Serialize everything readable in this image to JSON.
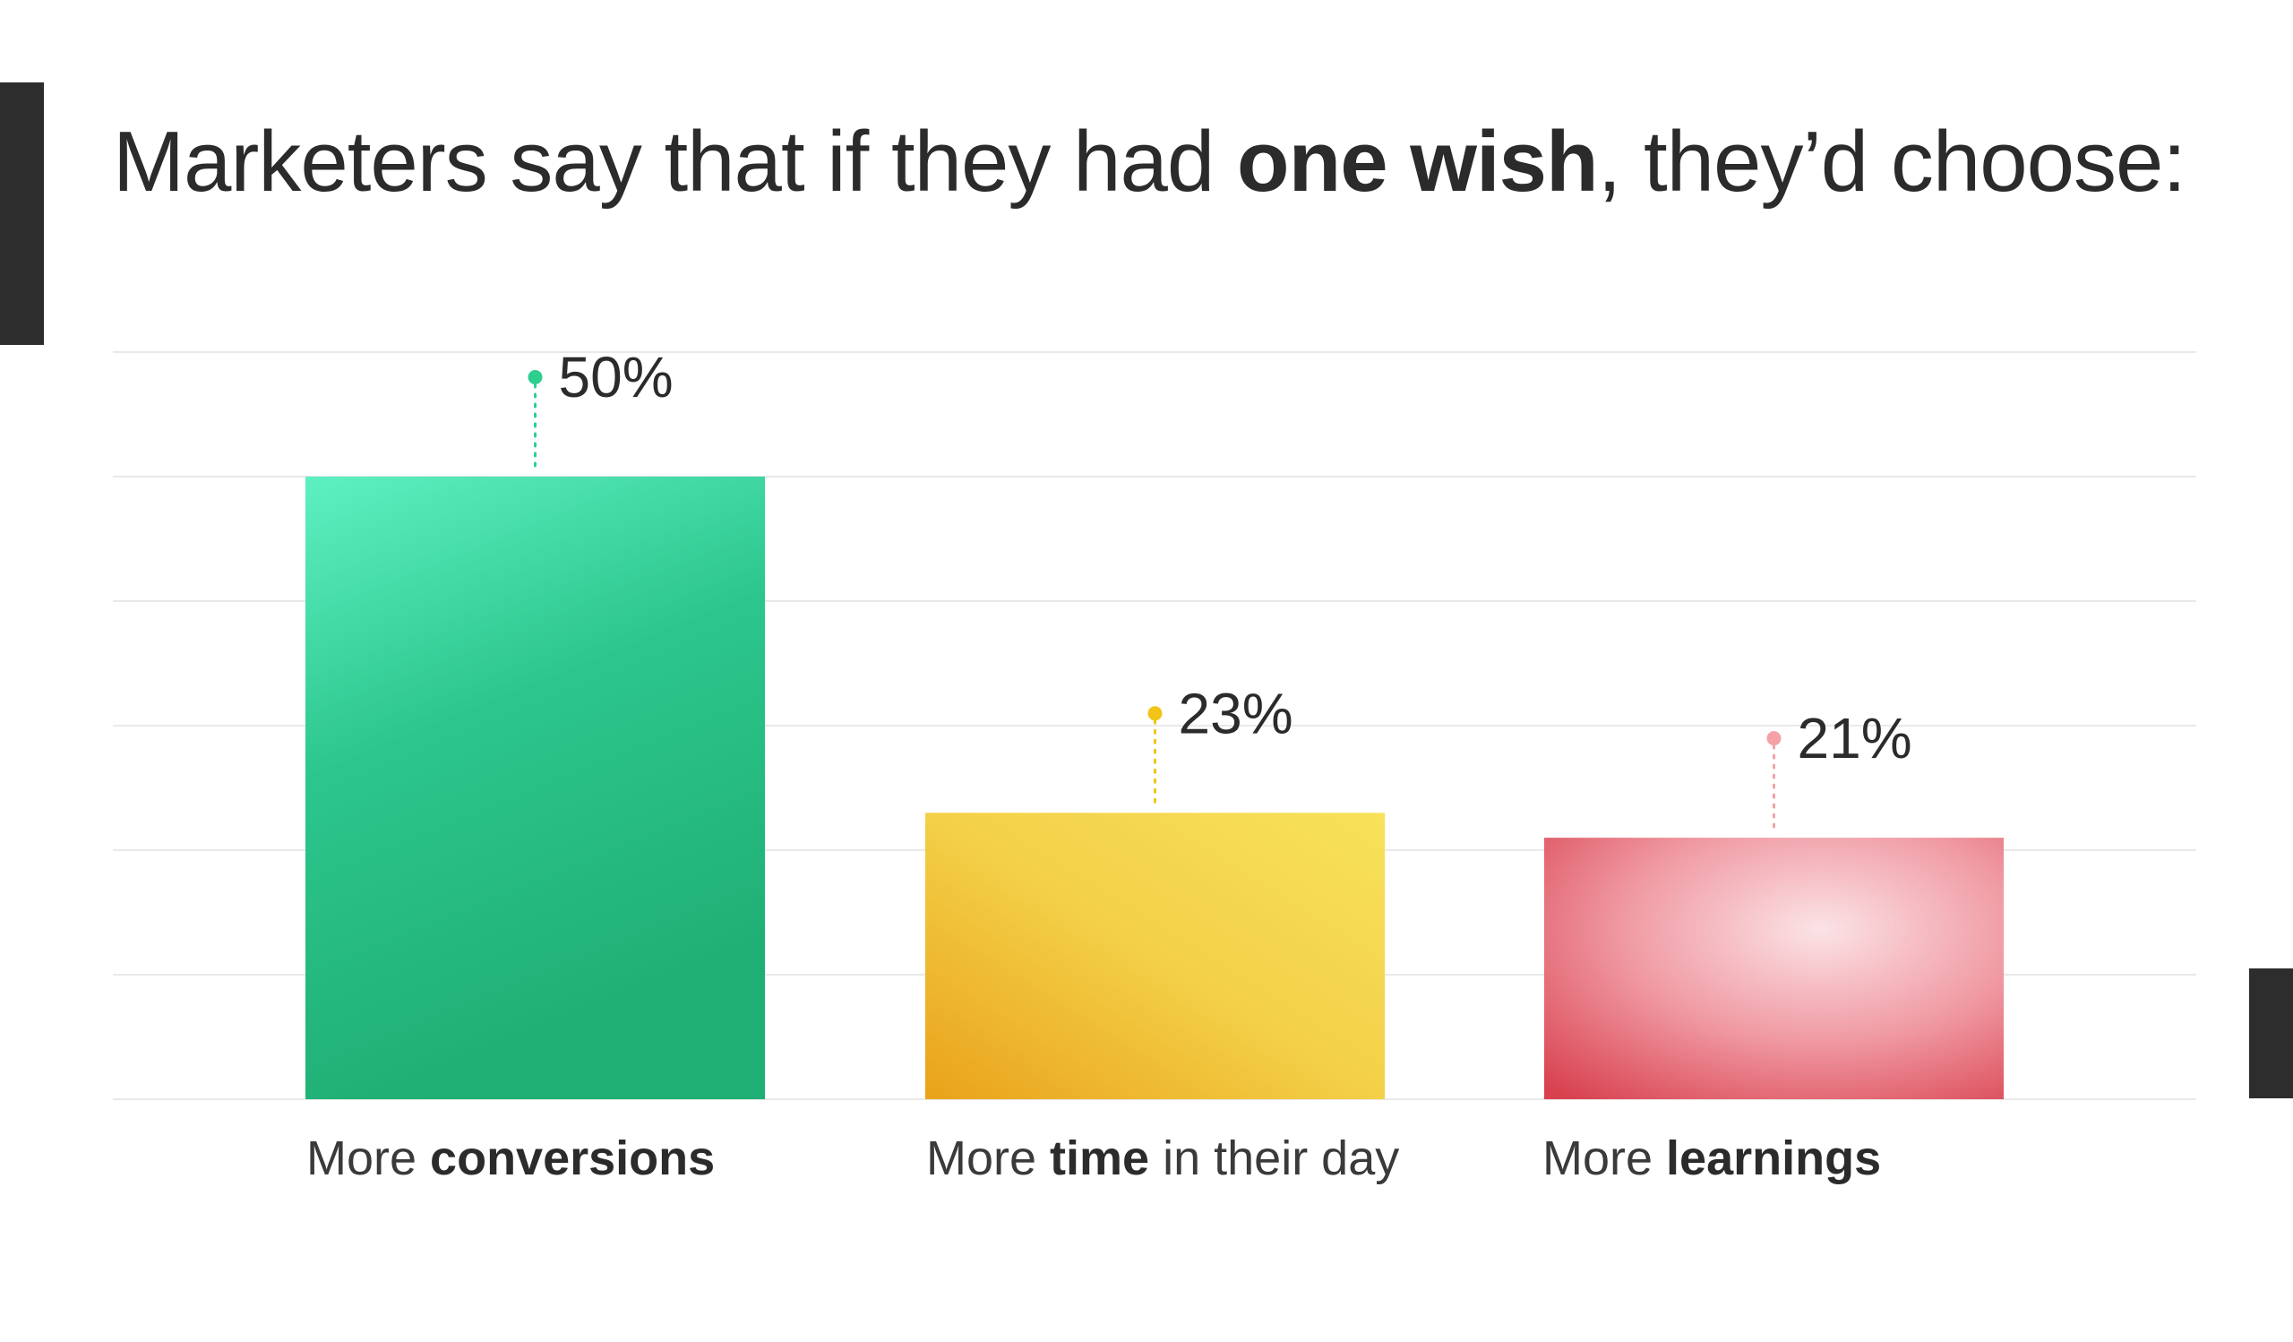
{
  "title": {
    "before": "Marketers say that if they had ",
    "emphasis": "one wish",
    "after": ", they’d choose:"
  },
  "chart_data": {
    "type": "bar",
    "title": "Marketers say that if they had one wish, they’d choose:",
    "categories": [
      "More conversions",
      "More time in their day",
      "More learnings"
    ],
    "category_parts": [
      {
        "prefix": "More ",
        "bold": "conversions",
        "suffix": ""
      },
      {
        "prefix": "More ",
        "bold": "time",
        "suffix": " in their day"
      },
      {
        "prefix": "More ",
        "bold": "learnings",
        "suffix": ""
      }
    ],
    "values": [
      50,
      23,
      21
    ],
    "value_labels": [
      "50%",
      "23%",
      "21%"
    ],
    "ylim": [
      0,
      60
    ],
    "grid": true,
    "colors": {
      "conversions": [
        "#5ef0c2",
        "#1fae74"
      ],
      "time": [
        "#f7e25a",
        "#e9a21a"
      ],
      "learnings": [
        "#fbe3e6",
        "#d8404e"
      ],
      "dots": [
        "#2ecf8e",
        "#f2c417",
        "#f4a1a8"
      ]
    }
  }
}
